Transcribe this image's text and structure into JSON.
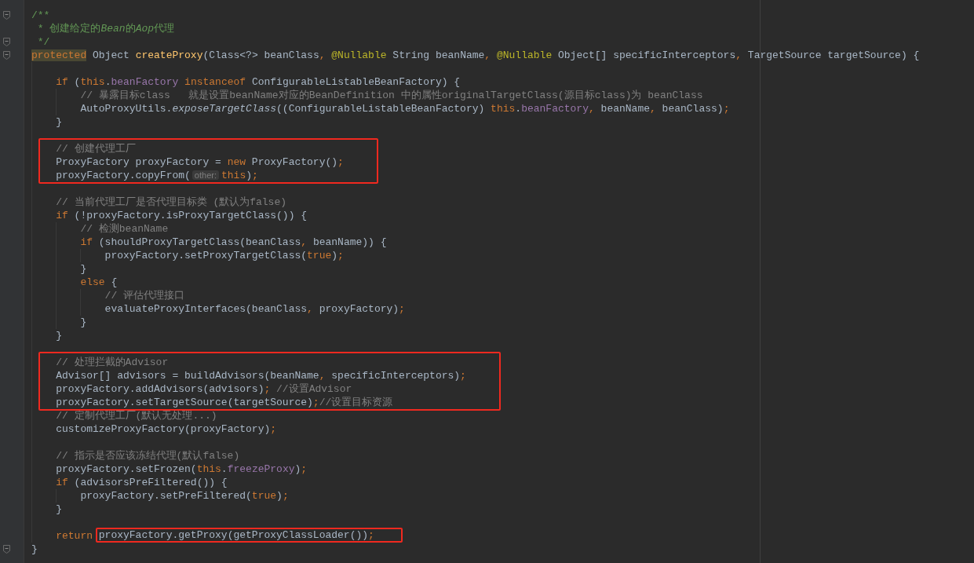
{
  "editor": {
    "lines": [
      {
        "kind": "code",
        "fold_marker": true,
        "tokens": [
          {
            "text": "/**",
            "kind": "doc"
          }
        ]
      },
      {
        "kind": "code",
        "tokens": [
          {
            "text": " * 创建给定的",
            "kind": "doc"
          },
          {
            "text": "Bean",
            "kind": "doc-italic"
          },
          {
            "text": "的",
            "kind": "doc"
          },
          {
            "text": "Aop",
            "kind": "doc-italic"
          },
          {
            "text": "代理",
            "kind": "doc"
          }
        ]
      },
      {
        "kind": "code",
        "fold_marker": true,
        "tokens": [
          {
            "text": " */",
            "kind": "doc"
          }
        ]
      },
      {
        "kind": "code",
        "fold_marker": true,
        "tokens": [
          {
            "text": "protected",
            "kind": "keyword-marked"
          },
          {
            "text": " Object ",
            "kind": "plain"
          },
          {
            "text": "createProxy",
            "kind": "declaration"
          },
          {
            "text": "(Class<?> beanClass",
            "kind": "plain"
          },
          {
            "text": ", ",
            "kind": "punct"
          },
          {
            "text": "@Nullable",
            "kind": "annotation"
          },
          {
            "text": " String beanName",
            "kind": "plain"
          },
          {
            "text": ", ",
            "kind": "punct"
          },
          {
            "text": "@Nullable",
            "kind": "annotation"
          },
          {
            "text": " Object[] specificInterceptors",
            "kind": "plain"
          },
          {
            "text": ", ",
            "kind": "punct"
          },
          {
            "text": "TargetSource targetSource) {",
            "kind": "plain"
          }
        ],
        "children": [
          {
            "kind": "blank"
          },
          {
            "kind": "code",
            "tokens": [
              {
                "text": "if",
                "kind": "keyword"
              },
              {
                "text": " (",
                "kind": "plain"
              },
              {
                "text": "this",
                "kind": "keyword"
              },
              {
                "text": ".",
                "kind": "plain"
              },
              {
                "text": "beanFactory",
                "kind": "field"
              },
              {
                "text": " instanceof",
                "kind": "keyword"
              },
              {
                "text": " ConfigurableListableBeanFactory) {",
                "kind": "plain"
              }
            ],
            "children": [
              {
                "kind": "code",
                "tokens": [
                  {
                    "text": "// 暴露目标class   就是设置beanName对应的BeanDefinition 中的属性originalTargetClass(源目标class)为 beanClass",
                    "kind": "comment"
                  }
                ]
              },
              {
                "kind": "code",
                "tokens": [
                  {
                    "text": "AutoProxyUtils.",
                    "kind": "plain"
                  },
                  {
                    "text": "exposeTargetClass",
                    "kind": "static-call"
                  },
                  {
                    "text": "((ConfigurableListableBeanFactory) ",
                    "kind": "plain"
                  },
                  {
                    "text": "this",
                    "kind": "keyword"
                  },
                  {
                    "text": ".",
                    "kind": "plain"
                  },
                  {
                    "text": "beanFactory",
                    "kind": "field"
                  },
                  {
                    "text": ", ",
                    "kind": "punct"
                  },
                  {
                    "text": "beanName",
                    "kind": "plain"
                  },
                  {
                    "text": ", ",
                    "kind": "punct"
                  },
                  {
                    "text": "beanClass)",
                    "kind": "plain"
                  },
                  {
                    "text": ";",
                    "kind": "punct"
                  }
                ]
              }
            ]
          },
          {
            "kind": "code",
            "tokens": [
              {
                "text": "}",
                "kind": "plain"
              }
            ]
          },
          {
            "kind": "blank"
          },
          {
            "kind": "box",
            "lines": [
              {
                "kind": "code",
                "tokens": [
                  {
                    "text": "// 创建代理工厂",
                    "kind": "comment"
                  }
                ]
              },
              {
                "kind": "code",
                "tokens": [
                  {
                    "text": "ProxyFactory proxyFactory = ",
                    "kind": "plain"
                  },
                  {
                    "text": "new",
                    "kind": "keyword"
                  },
                  {
                    "text": " ProxyFactory()",
                    "kind": "plain"
                  },
                  {
                    "text": ";",
                    "kind": "punct"
                  }
                ]
              },
              {
                "kind": "code",
                "tokens": [
                  {
                    "text": "proxyFactory.copyFrom(",
                    "kind": "plain"
                  },
                  {
                    "text": "other:",
                    "kind": "hint"
                  },
                  {
                    "text": "this",
                    "kind": "keyword"
                  },
                  {
                    "text": ")",
                    "kind": "plain"
                  },
                  {
                    "text": ";",
                    "kind": "punct"
                  }
                ]
              }
            ]
          },
          {
            "kind": "blank"
          },
          {
            "kind": "code",
            "tokens": [
              {
                "text": "// 当前代理工厂是否代理目标类 (默认为false)",
                "kind": "comment"
              }
            ]
          },
          {
            "kind": "code",
            "tokens": [
              {
                "text": "if",
                "kind": "keyword"
              },
              {
                "text": " (!proxyFactory.isProxyTargetClass()) {",
                "kind": "plain"
              }
            ],
            "children": [
              {
                "kind": "code",
                "tokens": [
                  {
                    "text": "// 检测beanName",
                    "kind": "comment"
                  }
                ]
              },
              {
                "kind": "code",
                "tokens": [
                  {
                    "text": "if",
                    "kind": "keyword"
                  },
                  {
                    "text": " (shouldProxyTargetClass(beanClass",
                    "kind": "plain"
                  },
                  {
                    "text": ", ",
                    "kind": "punct"
                  },
                  {
                    "text": "beanName)) {",
                    "kind": "plain"
                  }
                ],
                "children": [
                  {
                    "kind": "code",
                    "tokens": [
                      {
                        "text": "proxyFactory.setProxyTargetClass(",
                        "kind": "plain"
                      },
                      {
                        "text": "true",
                        "kind": "keyword"
                      },
                      {
                        "text": ")",
                        "kind": "plain"
                      },
                      {
                        "text": ";",
                        "kind": "punct"
                      }
                    ]
                  }
                ]
              },
              {
                "kind": "code",
                "tokens": [
                  {
                    "text": "}",
                    "kind": "plain"
                  }
                ]
              },
              {
                "kind": "code",
                "tokens": [
                  {
                    "text": "else",
                    "kind": "keyword"
                  },
                  {
                    "text": " {",
                    "kind": "plain"
                  }
                ],
                "children": [
                  {
                    "kind": "code",
                    "tokens": [
                      {
                        "text": "// 评估代理接口",
                        "kind": "comment"
                      }
                    ]
                  },
                  {
                    "kind": "code",
                    "tokens": [
                      {
                        "text": "evaluateProxyInterfaces(beanClass",
                        "kind": "plain"
                      },
                      {
                        "text": ", ",
                        "kind": "punct"
                      },
                      {
                        "text": "proxyFactory)",
                        "kind": "plain"
                      },
                      {
                        "text": ";",
                        "kind": "punct"
                      }
                    ]
                  }
                ]
              },
              {
                "kind": "code",
                "tokens": [
                  {
                    "text": "}",
                    "kind": "plain"
                  }
                ]
              }
            ]
          },
          {
            "kind": "code",
            "tokens": [
              {
                "text": "}",
                "kind": "plain"
              }
            ]
          },
          {
            "kind": "blank"
          },
          {
            "kind": "box",
            "lines": [
              {
                "kind": "code",
                "tokens": [
                  {
                    "text": "// 处理拦截的Advisor",
                    "kind": "comment"
                  }
                ]
              },
              {
                "kind": "code",
                "tokens": [
                  {
                    "text": "Advisor[] advisors = buildAdvisors(beanName",
                    "kind": "plain"
                  },
                  {
                    "text": ", ",
                    "kind": "punct"
                  },
                  {
                    "text": "specificInterceptors)",
                    "kind": "plain"
                  },
                  {
                    "text": ";",
                    "kind": "punct"
                  }
                ]
              },
              {
                "kind": "code",
                "tokens": [
                  {
                    "text": "proxyFactory.addAdvisors(advisors)",
                    "kind": "plain"
                  },
                  {
                    "text": ";",
                    "kind": "punct"
                  },
                  {
                    "text": " //设置Advisor",
                    "kind": "comment"
                  }
                ]
              },
              {
                "kind": "code",
                "tokens": [
                  {
                    "text": "proxyFactory.setTargetSource(targetSource)",
                    "kind": "plain"
                  },
                  {
                    "text": ";",
                    "kind": "punct"
                  },
                  {
                    "text": "//设置目标资源",
                    "kind": "comment"
                  }
                ]
              }
            ]
          },
          {
            "kind": "code",
            "tokens": [
              {
                "text": "// 定制代理工厂(默认无处理...)",
                "kind": "comment"
              }
            ]
          },
          {
            "kind": "code",
            "tokens": [
              {
                "text": "customizeProxyFactory(proxyFactory)",
                "kind": "plain"
              },
              {
                "text": ";",
                "kind": "punct"
              }
            ]
          },
          {
            "kind": "blank"
          },
          {
            "kind": "code",
            "tokens": [
              {
                "text": "// 指示是否应该冻结代理(默认false)",
                "kind": "comment"
              }
            ]
          },
          {
            "kind": "code",
            "tokens": [
              {
                "text": "proxyFactory.setFrozen(",
                "kind": "plain"
              },
              {
                "text": "this",
                "kind": "keyword"
              },
              {
                "text": ".",
                "kind": "plain"
              },
              {
                "text": "freezeProxy",
                "kind": "field"
              },
              {
                "text": ")",
                "kind": "plain"
              },
              {
                "text": ";",
                "kind": "punct"
              }
            ]
          },
          {
            "kind": "code",
            "tokens": [
              {
                "text": "if",
                "kind": "keyword"
              },
              {
                "text": " (advisorsPreFiltered()) {",
                "kind": "plain"
              }
            ],
            "children": [
              {
                "kind": "code",
                "tokens": [
                  {
                    "text": "proxyFactory.setPreFiltered(",
                    "kind": "plain"
                  },
                  {
                    "text": "true",
                    "kind": "keyword"
                  },
                  {
                    "text": ")",
                    "kind": "plain"
                  },
                  {
                    "text": ";",
                    "kind": "punct"
                  }
                ]
              }
            ]
          },
          {
            "kind": "code",
            "tokens": [
              {
                "text": "}",
                "kind": "plain"
              }
            ]
          },
          {
            "kind": "blank"
          },
          {
            "kind": "code",
            "tokens": [
              {
                "text": "return ",
                "kind": "keyword"
              },
              {
                "text": "proxyFactory.getProxy(getProxyClassLoader())",
                "kind": "plain",
                "boxed": true
              },
              {
                "text": ";",
                "kind": "punct",
                "boxed": true
              }
            ]
          }
        ]
      },
      {
        "kind": "code",
        "fold_marker": true,
        "tokens": [
          {
            "text": "}",
            "kind": "plain"
          }
        ]
      }
    ]
  }
}
